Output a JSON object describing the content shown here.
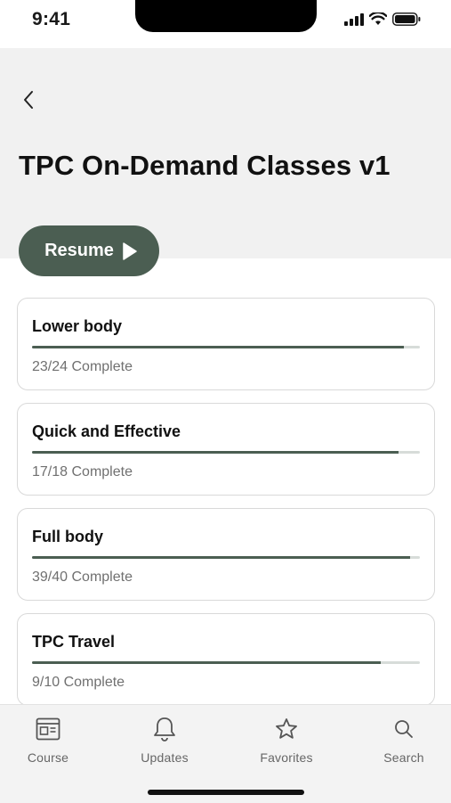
{
  "status_bar": {
    "time": "9:41"
  },
  "header": {
    "title": "TPC On-Demand Classes v1",
    "back_icon": "chevron-left-icon"
  },
  "resume": {
    "label": "Resume",
    "icon": "play-icon"
  },
  "colors": {
    "accent": "#4b5e52",
    "header_bg": "#f1f1f1",
    "muted_text": "#707070"
  },
  "courses": [
    {
      "title": "Lower body",
      "status": "23/24 Complete",
      "progress": 0.958
    },
    {
      "title": "Quick and Effective",
      "status": "17/18 Complete",
      "progress": 0.944
    },
    {
      "title": "Full body",
      "status": "39/40 Complete",
      "progress": 0.975
    },
    {
      "title": "TPC Travel",
      "status": "9/10 Complete",
      "progress": 0.9
    }
  ],
  "tabs": [
    {
      "label": "Course",
      "icon": "course-icon"
    },
    {
      "label": "Updates",
      "icon": "bell-icon"
    },
    {
      "label": "Favorites",
      "icon": "star-icon"
    },
    {
      "label": "Search",
      "icon": "search-icon"
    }
  ]
}
